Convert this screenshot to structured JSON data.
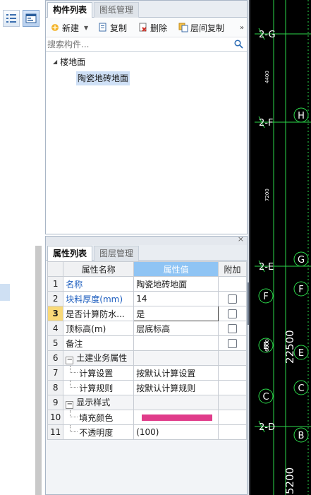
{
  "component_panel": {
    "tabs": [
      "构件列表",
      "图纸管理"
    ],
    "toolbar": {
      "new": "新建",
      "copy": "复制",
      "delete": "删除",
      "floor_copy": "层间复制",
      "more": "»"
    },
    "search_placeholder": "搜索构件...",
    "tree": {
      "root": "楼地面",
      "child": "陶瓷地砖地面"
    }
  },
  "property_panel": {
    "close": "×",
    "tabs": [
      "属性列表",
      "图层管理"
    ],
    "headers": {
      "name": "属性名称",
      "value": "属性值",
      "extra": "附加"
    },
    "rows": [
      {
        "num": "1",
        "name": "名称",
        "value": "陶瓷地砖地面"
      },
      {
        "num": "2",
        "name": "块料厚度(mm)",
        "value": "14"
      },
      {
        "num": "3",
        "name": "是否计算防水...",
        "value": "是"
      },
      {
        "num": "4",
        "name": "顶标高(m)",
        "value": "层底标高"
      },
      {
        "num": "5",
        "name": "备注",
        "value": ""
      },
      {
        "num": "6",
        "name": "土建业务属性",
        "value": ""
      },
      {
        "num": "7",
        "name": "计算设置",
        "value": "按默认计算设置"
      },
      {
        "num": "8",
        "name": "计算规则",
        "value": "按默认计算规则"
      },
      {
        "num": "9",
        "name": "显示样式",
        "value": ""
      },
      {
        "num": "10",
        "name": "填充颜色",
        "value": ""
      },
      {
        "num": "11",
        "name": "不透明度",
        "value": "(100)"
      }
    ],
    "fill_color": "#e03c8a"
  },
  "cad": {
    "axis_labels": [
      "2-G",
      "2-F",
      "2-E",
      "2-D"
    ],
    "dims_small": [
      "4400",
      "7200",
      "6900"
    ],
    "dims_big": [
      "22500",
      "5200"
    ],
    "bubbles": [
      "H",
      "G",
      "F",
      "F",
      "E",
      "E",
      "C",
      "C",
      "B"
    ],
    "line_color": "#2bd94a"
  }
}
